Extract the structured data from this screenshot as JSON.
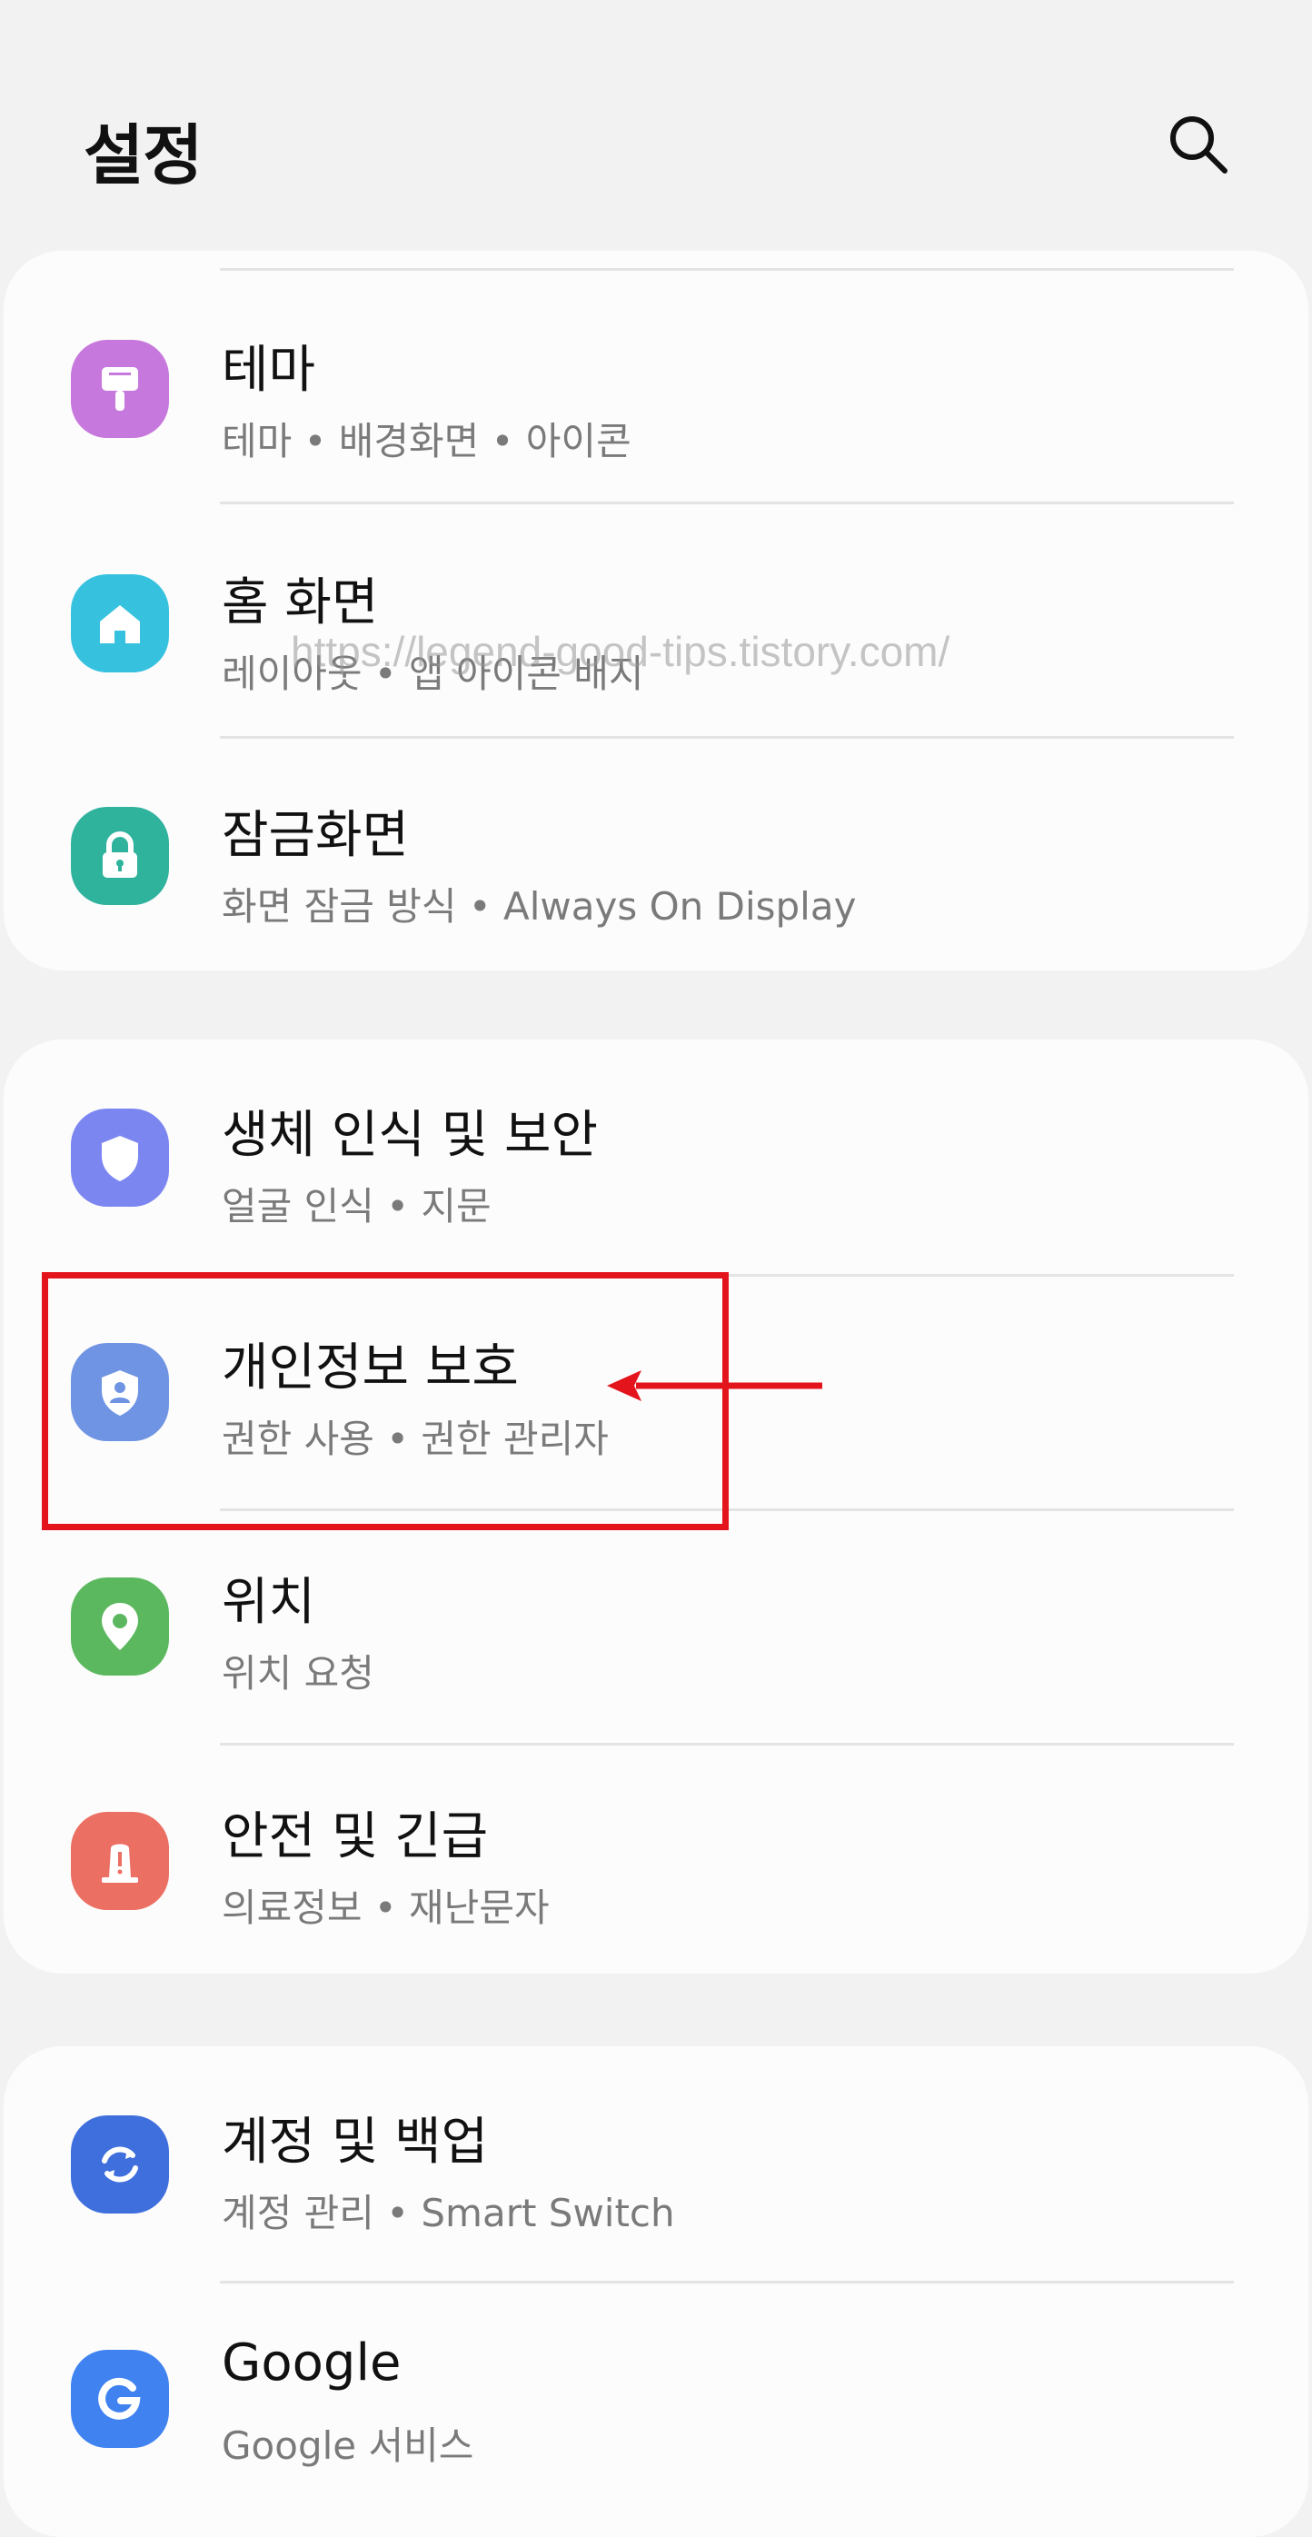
{
  "header": {
    "title": "설정",
    "search_icon": "search-icon"
  },
  "watermark": "https://legend-good-tips.tistory.com/",
  "rows": [
    {
      "title": "테마",
      "subtitle": "테마  •  배경화면  •  아이콘",
      "icon": "theme-brush-icon",
      "color": "#c778dd"
    },
    {
      "title": "홈 화면",
      "subtitle": "레이아웃  •  앱 아이콘 배지",
      "icon": "home-icon",
      "color": "#36c2df"
    },
    {
      "title": "잠금화면",
      "subtitle": "화면 잠금 방식  •  Always On Display",
      "icon": "lock-icon",
      "color": "#2fb39d"
    },
    {
      "title": "생체 인식 및 보안",
      "subtitle": "얼굴 인식  •  지문",
      "icon": "shield-icon",
      "color": "#7b86f0"
    },
    {
      "title": "개인정보 보호",
      "subtitle": "권한 사용  •  권한 관리자",
      "icon": "privacy-shield-icon",
      "color": "#6f94e3"
    },
    {
      "title": "위치",
      "subtitle": "위치 요청",
      "icon": "location-pin-icon",
      "color": "#5cb85f"
    },
    {
      "title": "안전 및 긴급",
      "subtitle": "의료정보  •  재난문자",
      "icon": "emergency-alert-icon",
      "color": "#ec6f63"
    },
    {
      "title": "계정 및 백업",
      "subtitle": "계정 관리  •  Smart Switch",
      "icon": "sync-icon",
      "color": "#3f6fdc"
    },
    {
      "title": "Google",
      "subtitle": "Google 서비스",
      "icon": "google-icon",
      "color": "#3f82f0"
    }
  ],
  "annotation": {
    "highlight_color": "#e3141b",
    "target": "개인정보 보호"
  }
}
